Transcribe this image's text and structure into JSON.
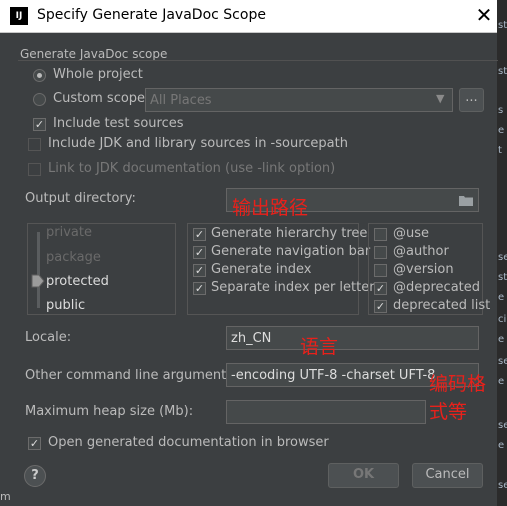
{
  "window": {
    "title": "Specify Generate JavaDoc Scope",
    "app_icon": "IJ"
  },
  "scope": {
    "section_label": "Generate JavaDoc scope",
    "whole_project": "Whole project",
    "custom_scope": "Custom scope",
    "custom_scope_value": "All Places",
    "browse_label": "...",
    "include_test_sources": "Include test sources",
    "include_jdk": "Include JDK and library sources in -sourcepath",
    "link_jdk": "Link to JDK documentation (use -link option)"
  },
  "output": {
    "label": "Output directory:",
    "value": "",
    "annotation": "输出路径"
  },
  "visibility": {
    "levels": [
      "private",
      "package",
      "protected",
      "public"
    ],
    "selected": "protected"
  },
  "options": [
    {
      "label": "Generate hierarchy tree",
      "checked": true
    },
    {
      "label": "Generate navigation bar",
      "checked": true
    },
    {
      "label": "Generate index",
      "checked": true
    },
    {
      "label": "Separate index per letter",
      "checked": true
    }
  ],
  "tags": [
    {
      "label": "@use",
      "checked": false
    },
    {
      "label": "@author",
      "checked": false
    },
    {
      "label": "@version",
      "checked": false
    },
    {
      "label": "@deprecated",
      "checked": true
    },
    {
      "label": "deprecated list",
      "checked": true
    }
  ],
  "locale": {
    "label": "Locale:",
    "value": "zh_CN",
    "annotation": "语言"
  },
  "other_args": {
    "label": "Other command line arguments:",
    "value": "-encoding UTF-8 -charset UFT-8",
    "annotation_line1": "编码格",
    "annotation_line2": "式等"
  },
  "heap": {
    "label": "Maximum heap size (Mb):",
    "value": ""
  },
  "open_browser": {
    "label": "Open generated documentation in browser",
    "checked": true
  },
  "footer": {
    "help": "?",
    "ok": "OK",
    "cancel": "Cancel"
  },
  "background_fragments": [
    "st",
    "st",
    "s",
    "e",
    "t",
    "se",
    "st",
    "e",
    "ci",
    "e",
    "se",
    "e",
    "se",
    "e",
    "se"
  ],
  "bottom_fragment": "m"
}
